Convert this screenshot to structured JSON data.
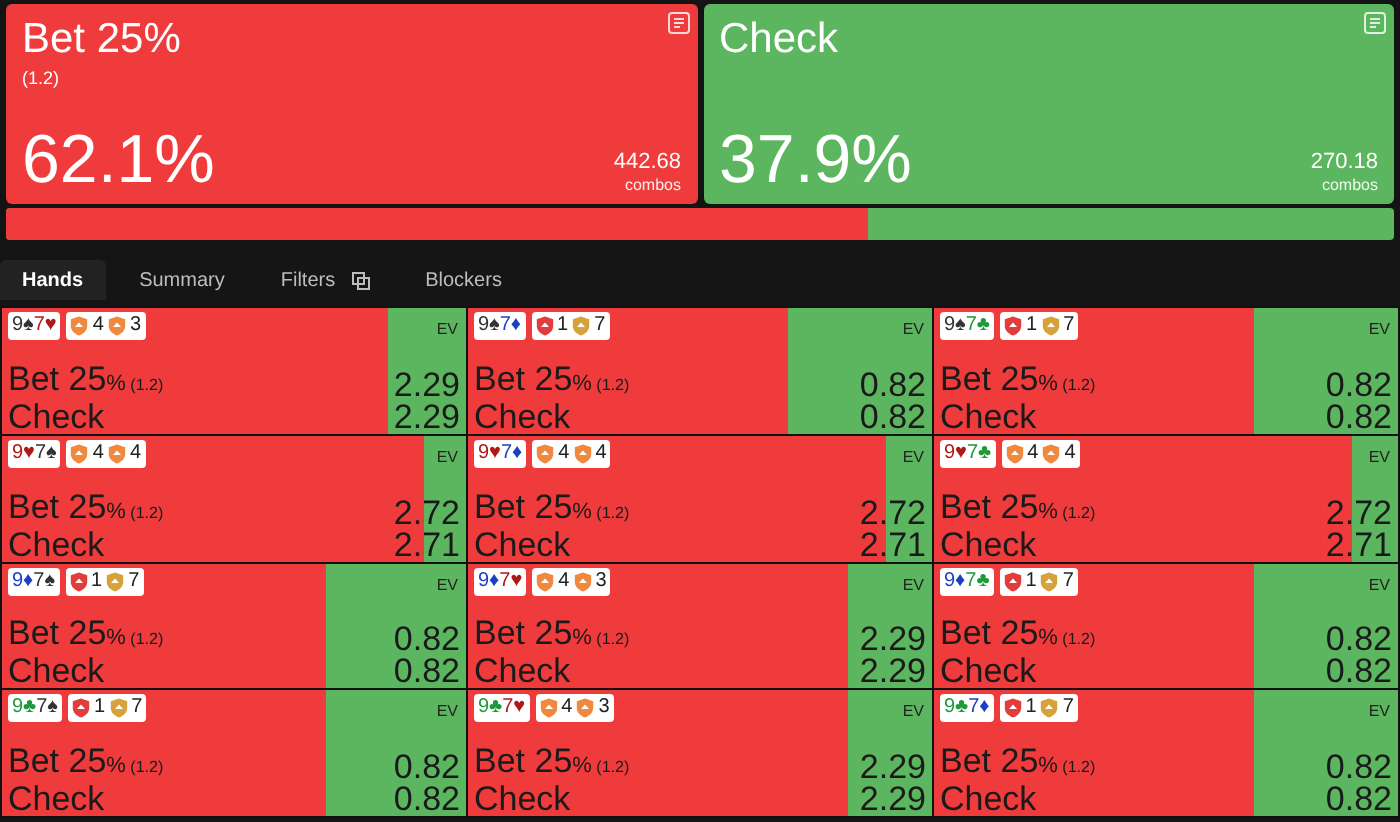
{
  "actions": [
    {
      "kind": "bet",
      "title": "Bet 25%",
      "sizing": "(1.2)",
      "percent": "62.1%",
      "combos": "442.68",
      "combos_label": "combos"
    },
    {
      "kind": "check",
      "title": "Check",
      "percent": "37.9%",
      "combos": "270.18",
      "combos_label": "combos"
    }
  ],
  "strategy_bar": {
    "level": 0.621
  },
  "tabs": [
    {
      "label": "Hands",
      "selected": true
    },
    {
      "label": "Summary",
      "selected": false
    },
    {
      "label": "Filters",
      "selected": false,
      "has_icon": true
    },
    {
      "label": "Blockers",
      "selected": false
    }
  ],
  "hands": [
    {
      "cards": [
        {
          "text": "9♠",
          "color": "#333333"
        },
        {
          "text": "7♥",
          "color": "#b01818"
        }
      ],
      "blockers": [
        {
          "color": "#f0883e",
          "value": "4"
        },
        {
          "color": "#f0883e",
          "value": "3"
        }
      ],
      "ev_label": "EV",
      "bet_label": "Bet 25",
      "pct": "%",
      "sizing": "(1.2)",
      "check_label": "Check",
      "bet_ev": "2.29",
      "check_ev": "2.29",
      "level": 0.17
    },
    {
      "cards": [
        {
          "text": "9♠",
          "color": "#333333"
        },
        {
          "text": "7♦",
          "color": "#1d3fc4"
        }
      ],
      "blockers": [
        {
          "color": "#e23c3c",
          "value": "1"
        },
        {
          "color": "#d8a23a",
          "value": "7"
        }
      ],
      "ev_label": "EV",
      "bet_label": "Bet 25",
      "pct": "%",
      "sizing": "(1.2)",
      "check_label": "Check",
      "bet_ev": "0.82",
      "check_ev": "0.82",
      "level": 0.31
    },
    {
      "cards": [
        {
          "text": "9♠",
          "color": "#333333"
        },
        {
          "text": "7♣",
          "color": "#1f9a3a"
        }
      ],
      "blockers": [
        {
          "color": "#e23c3c",
          "value": "1"
        },
        {
          "color": "#d8a23a",
          "value": "7"
        }
      ],
      "ev_label": "EV",
      "bet_label": "Bet 25",
      "pct": "%",
      "sizing": "(1.2)",
      "check_label": "Check",
      "bet_ev": "0.82",
      "check_ev": "0.82",
      "level": 0.31
    },
    {
      "cards": [
        {
          "text": "9♥",
          "color": "#b01818"
        },
        {
          "text": "7♠",
          "color": "#333333"
        }
      ],
      "blockers": [
        {
          "color": "#f0883e",
          "value": "4"
        },
        {
          "color": "#f0883e",
          "value": "4"
        }
      ],
      "ev_label": "EV",
      "bet_label": "Bet 25",
      "pct": "%",
      "sizing": "(1.2)",
      "check_label": "Check",
      "bet_ev": "2.72",
      "check_ev": "2.71",
      "level": 0.09
    },
    {
      "cards": [
        {
          "text": "9♥",
          "color": "#b01818"
        },
        {
          "text": "7♦",
          "color": "#1d3fc4"
        }
      ],
      "blockers": [
        {
          "color": "#f0883e",
          "value": "4"
        },
        {
          "color": "#f0883e",
          "value": "4"
        }
      ],
      "ev_label": "EV",
      "bet_label": "Bet 25",
      "pct": "%",
      "sizing": "(1.2)",
      "check_label": "Check",
      "bet_ev": "2.72",
      "check_ev": "2.71",
      "level": 0.1
    },
    {
      "cards": [
        {
          "text": "9♥",
          "color": "#b01818"
        },
        {
          "text": "7♣",
          "color": "#1f9a3a"
        }
      ],
      "blockers": [
        {
          "color": "#f0883e",
          "value": "4"
        },
        {
          "color": "#f0883e",
          "value": "4"
        }
      ],
      "ev_label": "EV",
      "bet_label": "Bet 25",
      "pct": "%",
      "sizing": "(1.2)",
      "check_label": "Check",
      "bet_ev": "2.72",
      "check_ev": "2.71",
      "level": 0.1
    },
    {
      "cards": [
        {
          "text": "9♦",
          "color": "#1d3fc4"
        },
        {
          "text": "7♠",
          "color": "#333333"
        }
      ],
      "blockers": [
        {
          "color": "#e23c3c",
          "value": "1"
        },
        {
          "color": "#d8a23a",
          "value": "7"
        }
      ],
      "ev_label": "EV",
      "bet_label": "Bet 25",
      "pct": "%",
      "sizing": "(1.2)",
      "check_label": "Check",
      "bet_ev": "0.82",
      "check_ev": "0.82",
      "level": 0.3
    },
    {
      "cards": [
        {
          "text": "9♦",
          "color": "#1d3fc4"
        },
        {
          "text": "7♥",
          "color": "#b01818"
        }
      ],
      "blockers": [
        {
          "color": "#f0883e",
          "value": "4"
        },
        {
          "color": "#f0883e",
          "value": "3"
        }
      ],
      "ev_label": "EV",
      "bet_label": "Bet 25",
      "pct": "%",
      "sizing": "(1.2)",
      "check_label": "Check",
      "bet_ev": "2.29",
      "check_ev": "2.29",
      "level": 0.18
    },
    {
      "cards": [
        {
          "text": "9♦",
          "color": "#1d3fc4"
        },
        {
          "text": "7♣",
          "color": "#1f9a3a"
        }
      ],
      "blockers": [
        {
          "color": "#e23c3c",
          "value": "1"
        },
        {
          "color": "#d8a23a",
          "value": "7"
        }
      ],
      "ev_label": "EV",
      "bet_label": "Bet 25",
      "pct": "%",
      "sizing": "(1.2)",
      "check_label": "Check",
      "bet_ev": "0.82",
      "check_ev": "0.82",
      "level": 0.31
    },
    {
      "cards": [
        {
          "text": "9♣",
          "color": "#1f9a3a"
        },
        {
          "text": "7♠",
          "color": "#333333"
        }
      ],
      "blockers": [
        {
          "color": "#e23c3c",
          "value": "1"
        },
        {
          "color": "#d8a23a",
          "value": "7"
        }
      ],
      "ev_label": "EV",
      "bet_label": "Bet 25",
      "pct": "%",
      "sizing": "(1.2)",
      "check_label": "Check",
      "bet_ev": "0.82",
      "check_ev": "0.82",
      "level": 0.3
    },
    {
      "cards": [
        {
          "text": "9♣",
          "color": "#1f9a3a"
        },
        {
          "text": "7♥",
          "color": "#b01818"
        }
      ],
      "blockers": [
        {
          "color": "#f0883e",
          "value": "4"
        },
        {
          "color": "#f0883e",
          "value": "3"
        }
      ],
      "ev_label": "EV",
      "bet_label": "Bet 25",
      "pct": "%",
      "sizing": "(1.2)",
      "check_label": "Check",
      "bet_ev": "2.29",
      "check_ev": "2.29",
      "level": 0.18
    },
    {
      "cards": [
        {
          "text": "9♣",
          "color": "#1f9a3a"
        },
        {
          "text": "7♦",
          "color": "#1d3fc4"
        }
      ],
      "blockers": [
        {
          "color": "#e23c3c",
          "value": "1"
        },
        {
          "color": "#d8a23a",
          "value": "7"
        }
      ],
      "ev_label": "EV",
      "bet_label": "Bet 25",
      "pct": "%",
      "sizing": "(1.2)",
      "check_label": "Check",
      "bet_ev": "0.82",
      "check_ev": "0.82",
      "level": 0.31
    }
  ]
}
